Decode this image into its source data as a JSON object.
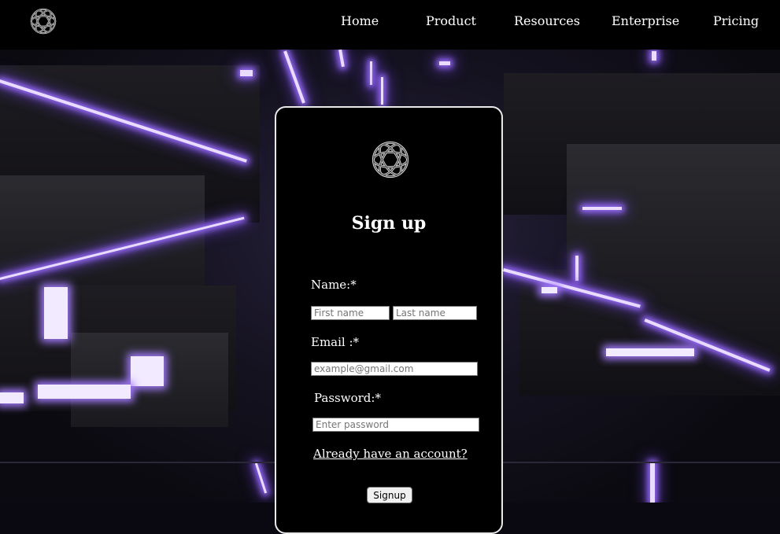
{
  "nav": {
    "logo_icon": "knot-logo-icon",
    "links": [
      "Home",
      "Product",
      "Resources",
      "Enterprise",
      "Pricing"
    ]
  },
  "form": {
    "logo_icon": "knot-logo-icon",
    "title": "Sign up",
    "name_label": "Name:*",
    "first_name_placeholder": "First name",
    "last_name_placeholder": "Last name",
    "email_label": "Email :*",
    "email_placeholder": "example@gmail.com",
    "password_label": "Password:*",
    "password_placeholder": "Enter password",
    "login_link": "Already have an account?",
    "submit_label": "Signup"
  },
  "colors": {
    "nav_bg": "#000000",
    "card_bg": "#000000",
    "card_border": "#e9e9e9",
    "glow": "#a57cff"
  }
}
